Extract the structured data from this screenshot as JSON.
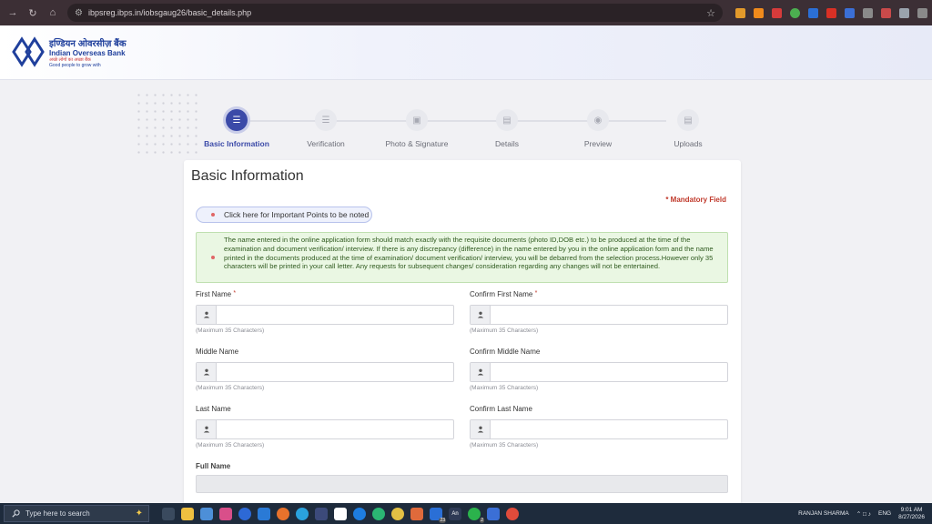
{
  "browser": {
    "url": "ibpsreg.ibps.in/iobsgaug26/basic_details.php"
  },
  "header": {
    "bank_name_hindi": "इण्डियन ओवरसीज़ बैंक",
    "bank_name": "Indian Overseas Bank",
    "slogan_hindi": "अच्छे लोगों का अच्छा बैंक",
    "tagline": "Good people to grow with"
  },
  "stepper": {
    "steps": [
      {
        "label": "Basic Information",
        "icon": "list-icon",
        "active": true
      },
      {
        "label": "Verification",
        "icon": "list-icon",
        "active": false
      },
      {
        "label": "Photo & Signature",
        "icon": "image-icon",
        "active": false
      },
      {
        "label": "Details",
        "icon": "document-icon",
        "active": false
      },
      {
        "label": "Preview",
        "icon": "eye-icon",
        "active": false
      },
      {
        "label": "Uploads",
        "icon": "document-icon",
        "active": false
      }
    ]
  },
  "form": {
    "title": "Basic Information",
    "mandatory_label": "* Mandatory Field",
    "important_points_label": "Click here for Important Points to be noted",
    "notice": "The name entered in the online application form should match exactly with the requisite documents (photo ID,DOB etc.) to be produced at the time of the examination and document verification/ interview. If there is any discrepancy (difference) in the name entered by you in the online application form and the name printed in the documents produced at the time of examination/ document verification/ interview, you will be debarred from the selection process.However only 35 characters will be printed in your call letter. Any requests for subsequent changes/ consideration regarding any changes will not be entertained.",
    "fields": {
      "first_name": {
        "label": "First Name",
        "hint": "(Maximum 35 Characters)",
        "value": ""
      },
      "confirm_first_name": {
        "label": "Confirm First Name",
        "hint": "(Maximum 35 Characters)",
        "value": ""
      },
      "middle_name": {
        "label": "Middle Name",
        "hint": "(Maximum 35 Characters)",
        "value": ""
      },
      "confirm_middle_name": {
        "label": "Confirm Middle Name",
        "hint": "(Maximum 35 Characters)",
        "value": ""
      },
      "last_name": {
        "label": "Last Name",
        "hint": "(Maximum 35 Characters)",
        "value": ""
      },
      "confirm_last_name": {
        "label": "Confirm Last Name",
        "hint": "(Maximum 35 Characters)",
        "value": ""
      },
      "full_name": {
        "label": "Full Name"
      }
    },
    "required_marker": "*"
  },
  "taskbar": {
    "search_placeholder": "Type here to search",
    "user": "RANJAN SHARMA",
    "language": "ENG",
    "time": "9:01 AM",
    "date": "8/27/2026",
    "badge_1": "23",
    "badge_2": "2",
    "badge_3": "An"
  }
}
